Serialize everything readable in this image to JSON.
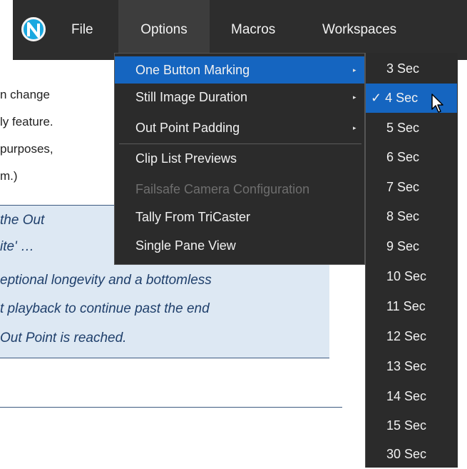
{
  "document": {
    "text_lines": [
      "n change",
      "ly  feature.",
      "purposes,",
      "m.)"
    ],
    "callout_lines": [
      "the Out",
      "ite' …",
      "eptional longevity and a bottomless",
      "t playback to continue past the end",
      "Out Point is reached."
    ]
  },
  "menubar": {
    "logo_icon": "app-logo-icon",
    "items": [
      {
        "label": "File"
      },
      {
        "label": "Options"
      },
      {
        "label": "Macros"
      },
      {
        "label": "Workspaces"
      }
    ]
  },
  "options_menu": {
    "items": [
      {
        "label": "One Button Marking",
        "submenu": true,
        "highlighted": true
      },
      {
        "label": "Still Image Duration",
        "submenu": true
      },
      {
        "label": "Out Point Padding",
        "submenu": true
      },
      {
        "label": "Clip List Previews"
      },
      {
        "label": "Failsafe Camera Configuration",
        "disabled": true
      },
      {
        "label": "Tally From TriCaster"
      },
      {
        "label": "Single Pane View"
      }
    ],
    "arrow_glyph": "▸"
  },
  "duration_submenu": {
    "selected_label": "✓ 4 Sec",
    "items": [
      "3 Sec",
      "4 Sec",
      "5 Sec",
      "6 Sec",
      "7 Sec",
      "8 Sec",
      "9 Sec",
      "10 Sec",
      "11 Sec",
      "12 Sec",
      "13 Sec",
      "14 Sec",
      "15 Sec",
      "30 Sec"
    ]
  },
  "colors": {
    "menubar_bg": "#2d2d2d",
    "highlight": "#1565c0",
    "callout_bg": "#dde8f3",
    "callout_text": "#1f3f6b"
  }
}
